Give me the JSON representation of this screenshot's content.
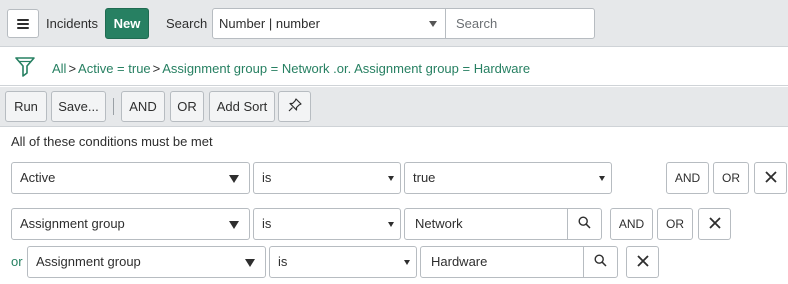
{
  "header": {
    "title": "Incidents",
    "new_label": "New",
    "search_label": "Search",
    "field_select": "Number | number",
    "search_placeholder": "Search"
  },
  "breadcrumb": {
    "items": [
      "All",
      "Active = true",
      "Assignment group = Network .or. Assignment group = Hardware"
    ],
    "separator": ">"
  },
  "toolbar": {
    "run": "Run",
    "save": "Save...",
    "and": "AND",
    "or": "OR",
    "add_sort": "Add Sort"
  },
  "conditions": {
    "heading": "All of these conditions must be met",
    "rows": [
      {
        "field": "Active",
        "operator": "is",
        "value": "true",
        "and": "AND",
        "or": "OR"
      },
      {
        "field": "Assignment group",
        "operator": "is",
        "value": "Network",
        "and": "AND",
        "or": "OR"
      },
      {
        "prefix": "or",
        "field": "Assignment group",
        "operator": "is",
        "value": "Hardware"
      }
    ]
  },
  "colors": {
    "accent": "#278062",
    "header_bg": "#e6e8ea",
    "border": "#b7bcc1"
  },
  "icons": [
    "hamburger-menu-icon",
    "dropdown-arrow-icon",
    "filter-funnel-icon",
    "pin-icon",
    "magnifier-icon",
    "close-icon"
  ]
}
